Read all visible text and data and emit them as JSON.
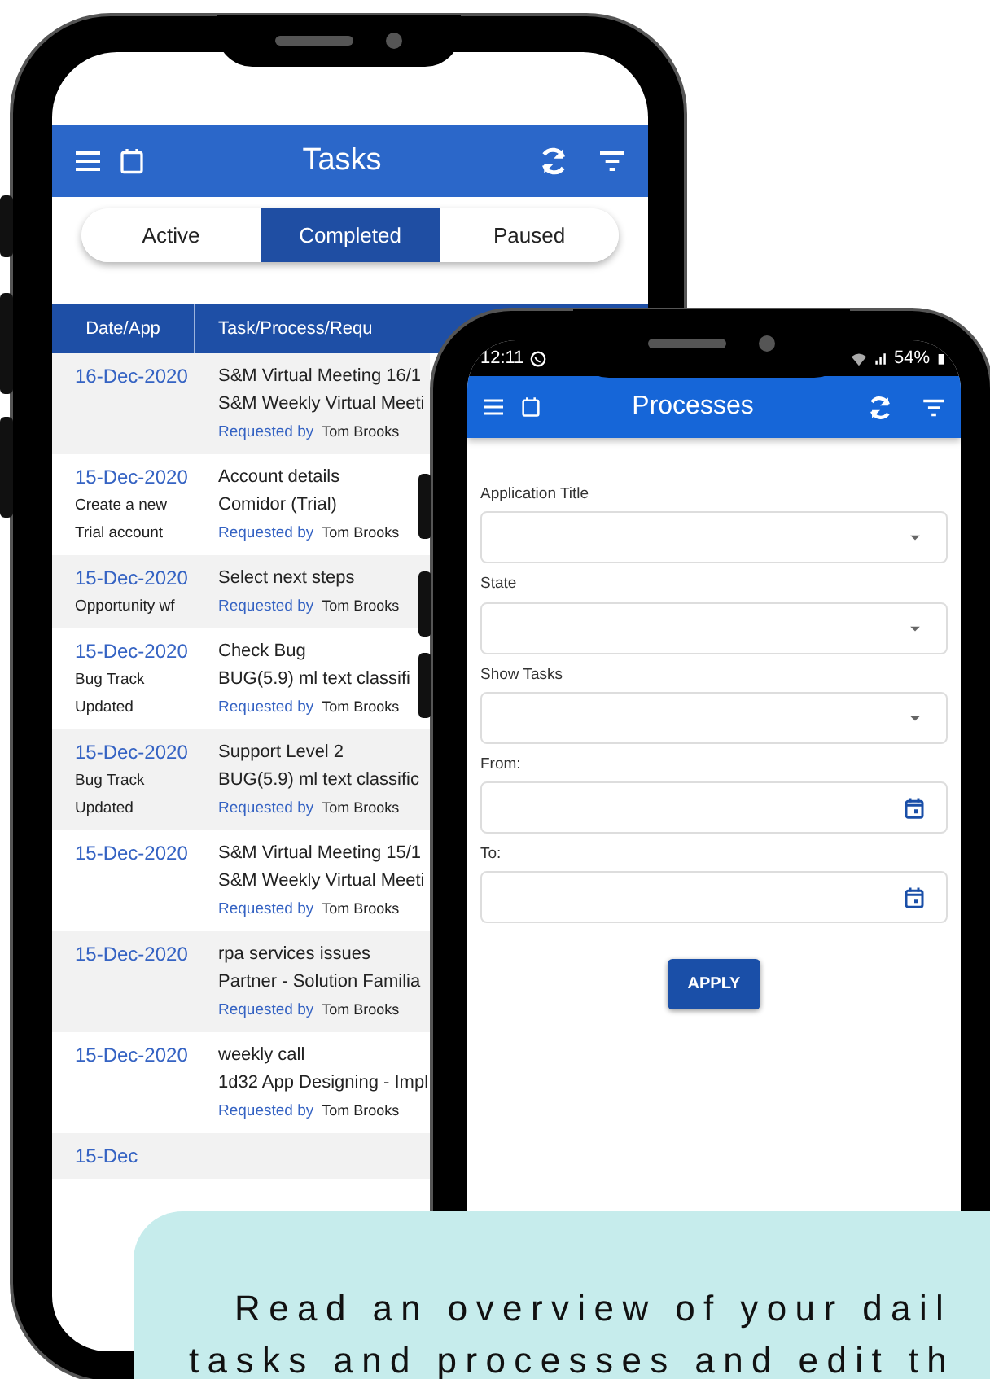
{
  "tasks_phone": {
    "app_bar": {
      "title": "Tasks"
    },
    "tabs": [
      {
        "label": "Active",
        "selected": false
      },
      {
        "label": "Completed",
        "selected": true
      },
      {
        "label": "Paused",
        "selected": false
      }
    ],
    "table": {
      "columns": [
        "Date/App",
        "Task/Process/Requ"
      ],
      "rows": [
        {
          "date": "16-Dec-2020",
          "task_lines": [
            "S&M Virtual Meeting 16/1",
            "S&M Weekly Virtual Meeti"
          ],
          "requested_label": "Requested by",
          "requester": "Tom Brooks"
        },
        {
          "date": "15-Dec-2020",
          "app_lines": [
            "Create a new",
            "Trial account"
          ],
          "task_lines": [
            "Account details",
            "Comidor (Trial)"
          ],
          "requested_label": "Requested by",
          "requester": "Tom Brooks"
        },
        {
          "date": "15-Dec-2020",
          "app_lines": [
            "Opportunity wf"
          ],
          "task_lines": [
            "Select next steps"
          ],
          "requested_label": "Requested by",
          "requester": "Tom Brooks"
        },
        {
          "date": "15-Dec-2020",
          "app_lines": [
            "Bug Track",
            "Updated"
          ],
          "task_lines": [
            "Check Bug",
            "BUG(5.9) ml text classifi"
          ],
          "requested_label": "Requested by",
          "requester": "Tom Brooks"
        },
        {
          "date": "15-Dec-2020",
          "app_lines": [
            "Bug Track",
            "Updated"
          ],
          "task_lines": [
            "Support Level 2",
            "BUG(5.9) ml text classific"
          ],
          "requested_label": "Requested by",
          "requester": "Tom Brooks"
        },
        {
          "date": "15-Dec-2020",
          "task_lines": [
            "S&M Virtual Meeting 15/1",
            "S&M Weekly Virtual Meeti"
          ],
          "requested_label": "Requested by",
          "requester": "Tom Brooks"
        },
        {
          "date": "15-Dec-2020",
          "task_lines": [
            "rpa services issues",
            "Partner  - Solution Familia"
          ],
          "requested_label": "Requested by",
          "requester": "Tom Brooks"
        },
        {
          "date": "15-Dec-2020",
          "task_lines": [
            "weekly call",
            "1d32 App Designing - Impl"
          ],
          "requested_label": "Requested by",
          "requester": "Tom Brooks"
        },
        {
          "date": "15-Dec"
        }
      ]
    }
  },
  "processes_phone": {
    "status_bar": {
      "time": "12:11",
      "battery": "54%"
    },
    "app_bar": {
      "title": "Processes"
    },
    "form": {
      "fields": [
        {
          "label": "Application Title",
          "kind": "dropdown"
        },
        {
          "label": "State",
          "kind": "dropdown"
        },
        {
          "label": "Show Tasks",
          "kind": "dropdown"
        },
        {
          "label": "From:",
          "kind": "date"
        },
        {
          "label": "To:",
          "kind": "date"
        }
      ],
      "button": "APPLY"
    }
  },
  "caption": {
    "lines": [
      "Read an overview of your dail",
      "tasks and processes and edit th"
    ]
  }
}
